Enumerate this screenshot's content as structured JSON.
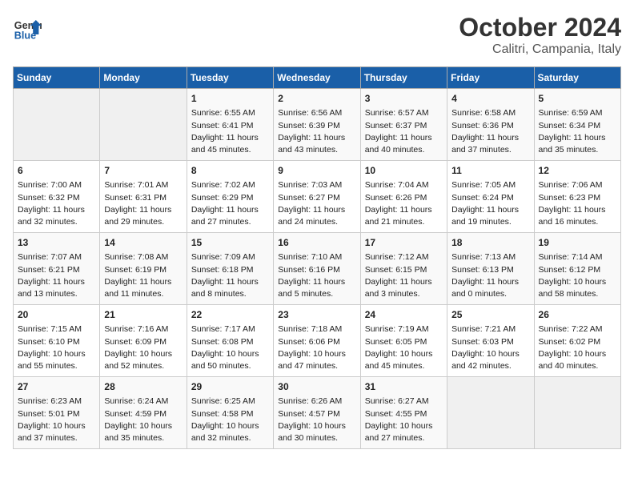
{
  "header": {
    "logo_line1": "General",
    "logo_line2": "Blue",
    "title": "October 2024",
    "subtitle": "Calitri, Campania, Italy"
  },
  "weekdays": [
    "Sunday",
    "Monday",
    "Tuesday",
    "Wednesday",
    "Thursday",
    "Friday",
    "Saturday"
  ],
  "weeks": [
    [
      {
        "day": "",
        "content": ""
      },
      {
        "day": "",
        "content": ""
      },
      {
        "day": "1",
        "content": "Sunrise: 6:55 AM\nSunset: 6:41 PM\nDaylight: 11 hours\nand 45 minutes."
      },
      {
        "day": "2",
        "content": "Sunrise: 6:56 AM\nSunset: 6:39 PM\nDaylight: 11 hours\nand 43 minutes."
      },
      {
        "day": "3",
        "content": "Sunrise: 6:57 AM\nSunset: 6:37 PM\nDaylight: 11 hours\nand 40 minutes."
      },
      {
        "day": "4",
        "content": "Sunrise: 6:58 AM\nSunset: 6:36 PM\nDaylight: 11 hours\nand 37 minutes."
      },
      {
        "day": "5",
        "content": "Sunrise: 6:59 AM\nSunset: 6:34 PM\nDaylight: 11 hours\nand 35 minutes."
      }
    ],
    [
      {
        "day": "6",
        "content": "Sunrise: 7:00 AM\nSunset: 6:32 PM\nDaylight: 11 hours\nand 32 minutes."
      },
      {
        "day": "7",
        "content": "Sunrise: 7:01 AM\nSunset: 6:31 PM\nDaylight: 11 hours\nand 29 minutes."
      },
      {
        "day": "8",
        "content": "Sunrise: 7:02 AM\nSunset: 6:29 PM\nDaylight: 11 hours\nand 27 minutes."
      },
      {
        "day": "9",
        "content": "Sunrise: 7:03 AM\nSunset: 6:27 PM\nDaylight: 11 hours\nand 24 minutes."
      },
      {
        "day": "10",
        "content": "Sunrise: 7:04 AM\nSunset: 6:26 PM\nDaylight: 11 hours\nand 21 minutes."
      },
      {
        "day": "11",
        "content": "Sunrise: 7:05 AM\nSunset: 6:24 PM\nDaylight: 11 hours\nand 19 minutes."
      },
      {
        "day": "12",
        "content": "Sunrise: 7:06 AM\nSunset: 6:23 PM\nDaylight: 11 hours\nand 16 minutes."
      }
    ],
    [
      {
        "day": "13",
        "content": "Sunrise: 7:07 AM\nSunset: 6:21 PM\nDaylight: 11 hours\nand 13 minutes."
      },
      {
        "day": "14",
        "content": "Sunrise: 7:08 AM\nSunset: 6:19 PM\nDaylight: 11 hours\nand 11 minutes."
      },
      {
        "day": "15",
        "content": "Sunrise: 7:09 AM\nSunset: 6:18 PM\nDaylight: 11 hours\nand 8 minutes."
      },
      {
        "day": "16",
        "content": "Sunrise: 7:10 AM\nSunset: 6:16 PM\nDaylight: 11 hours\nand 5 minutes."
      },
      {
        "day": "17",
        "content": "Sunrise: 7:12 AM\nSunset: 6:15 PM\nDaylight: 11 hours\nand 3 minutes."
      },
      {
        "day": "18",
        "content": "Sunrise: 7:13 AM\nSunset: 6:13 PM\nDaylight: 11 hours\nand 0 minutes."
      },
      {
        "day": "19",
        "content": "Sunrise: 7:14 AM\nSunset: 6:12 PM\nDaylight: 10 hours\nand 58 minutes."
      }
    ],
    [
      {
        "day": "20",
        "content": "Sunrise: 7:15 AM\nSunset: 6:10 PM\nDaylight: 10 hours\nand 55 minutes."
      },
      {
        "day": "21",
        "content": "Sunrise: 7:16 AM\nSunset: 6:09 PM\nDaylight: 10 hours\nand 52 minutes."
      },
      {
        "day": "22",
        "content": "Sunrise: 7:17 AM\nSunset: 6:08 PM\nDaylight: 10 hours\nand 50 minutes."
      },
      {
        "day": "23",
        "content": "Sunrise: 7:18 AM\nSunset: 6:06 PM\nDaylight: 10 hours\nand 47 minutes."
      },
      {
        "day": "24",
        "content": "Sunrise: 7:19 AM\nSunset: 6:05 PM\nDaylight: 10 hours\nand 45 minutes."
      },
      {
        "day": "25",
        "content": "Sunrise: 7:21 AM\nSunset: 6:03 PM\nDaylight: 10 hours\nand 42 minutes."
      },
      {
        "day": "26",
        "content": "Sunrise: 7:22 AM\nSunset: 6:02 PM\nDaylight: 10 hours\nand 40 minutes."
      }
    ],
    [
      {
        "day": "27",
        "content": "Sunrise: 6:23 AM\nSunset: 5:01 PM\nDaylight: 10 hours\nand 37 minutes."
      },
      {
        "day": "28",
        "content": "Sunrise: 6:24 AM\nSunset: 4:59 PM\nDaylight: 10 hours\nand 35 minutes."
      },
      {
        "day": "29",
        "content": "Sunrise: 6:25 AM\nSunset: 4:58 PM\nDaylight: 10 hours\nand 32 minutes."
      },
      {
        "day": "30",
        "content": "Sunrise: 6:26 AM\nSunset: 4:57 PM\nDaylight: 10 hours\nand 30 minutes."
      },
      {
        "day": "31",
        "content": "Sunrise: 6:27 AM\nSunset: 4:55 PM\nDaylight: 10 hours\nand 27 minutes."
      },
      {
        "day": "",
        "content": ""
      },
      {
        "day": "",
        "content": ""
      }
    ]
  ]
}
